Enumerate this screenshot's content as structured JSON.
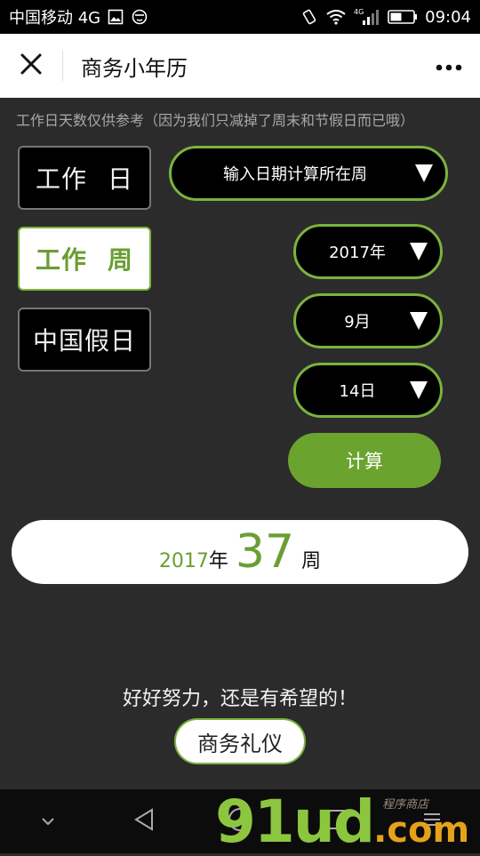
{
  "status_bar": {
    "carrier": "中国移动 4G",
    "network_badge": "4G",
    "time": "09:04",
    "icons": [
      "image-icon",
      "face-icon",
      "vibrate-icon",
      "wifi-icon",
      "signal-icon",
      "battery-icon"
    ]
  },
  "title_bar": {
    "title": "商务小年历",
    "close_icon": "close-icon",
    "more_icon": "more-dots-icon"
  },
  "notice": "工作日天数仅供参考（因为我们只减掉了周末和节假日而已哦）",
  "sidebar": {
    "items": [
      {
        "label_a": "工作",
        "label_b": "日",
        "active": false
      },
      {
        "label_a": "工作",
        "label_b": "周",
        "active": true
      },
      {
        "label": "中国假日",
        "active": false
      }
    ]
  },
  "controls": {
    "mode_select": "输入日期计算所在周",
    "year_select": "2017年",
    "month_select": "9月",
    "day_select": "14日",
    "calculate_label": "计算"
  },
  "result": {
    "year": "2017",
    "year_unit": "年",
    "week": "37",
    "week_unit": "周"
  },
  "slogan": "好好努力，还是有希望的！",
  "etiquette_label": "商务礼仪",
  "nav_bar": {
    "icons": [
      "chevron-down-icon",
      "back-triangle-icon",
      "home-circle-icon",
      "recent-square-icon",
      "menu-icon"
    ]
  },
  "watermark": {
    "main": "91ud",
    "tld": ".com",
    "slogan": "程序商店"
  },
  "colors": {
    "accent": "#7ab33d",
    "dark_bg": "#2b2b2b",
    "button_green": "#6aa42f"
  }
}
